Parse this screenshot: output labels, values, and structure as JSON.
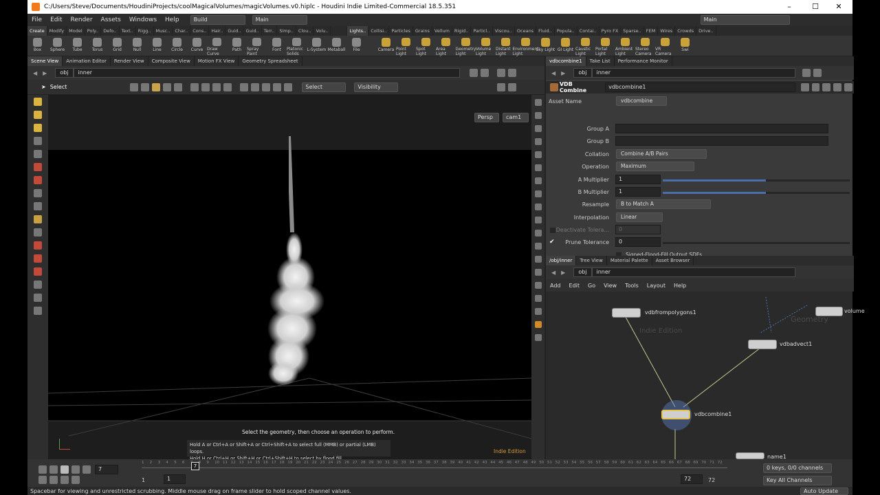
{
  "window": {
    "title": "C:/Users/Steve/Documents/HoudiniProjects/coolMagicalVolumes/magicVolumes.v0.hiplc - Houdini Indie Limited-Commercial 18.5.351",
    "min": "–",
    "max": "☐",
    "close": "✕"
  },
  "menu": {
    "items": [
      "File",
      "Edit",
      "Render",
      "Assets",
      "Windows",
      "Help"
    ],
    "desktop": "Build",
    "desktop2": "Main",
    "desktop_right": "Main"
  },
  "shelf_tabs_left": [
    "Create",
    "Modify",
    "Model",
    "Poly..",
    "Defo..",
    "Text..",
    "Rigg..",
    "Musc..",
    "Char..",
    "Cons..",
    "Hair..",
    "Guid..",
    "Guid..",
    "Terr..",
    "Simp..",
    "Clou..",
    "Volu.."
  ],
  "shelf_tabs_right": [
    "Lights..",
    "Collisi..",
    "Particles",
    "Grains",
    "Vellum",
    "Rigid..",
    "Particl..",
    "Viscou..",
    "Oceans",
    "Fluid..",
    "Popula..",
    "Contai..",
    "Pyro FX",
    "Sparse..",
    "FEM",
    "Wires",
    "Crowds",
    "Drive.."
  ],
  "tools_left": [
    "Box",
    "Sphere",
    "Tube",
    "Torus",
    "Grid",
    "Null",
    "Line",
    "Circle",
    "Curve",
    "Draw Curve",
    "Path",
    "Spray Paint",
    "Font",
    "Platonic Solids",
    "L-System",
    "Metaball",
    "File"
  ],
  "tools_right": [
    "Camera",
    "Point Light",
    "Spot Light",
    "Area Light",
    "Geometry Light",
    "Volume Light",
    "Distant Light",
    "Environment Light",
    "Sky Light",
    "GI Light",
    "Caustic Light",
    "Portal Light",
    "Ambient Light",
    "Stereo Camera",
    "VR Camera",
    "Swi"
  ],
  "left_tabs": [
    "Scene View",
    "Animation Editor",
    "Render View",
    "Composite View",
    "Motion FX View",
    "Geometry Spreadsheet"
  ],
  "path": {
    "obj": "obj",
    "node": "inner"
  },
  "viewport": {
    "select_label": "Select",
    "select_mode": "Select",
    "visibility": "Visibility",
    "persp": "Persp",
    "cam": "cam1",
    "hint_title": "Select the geometry, then choose an operation to perform.",
    "hint_line1": "Hold A or Ctrl+A or Shift+A or Ctrl+Shift+A to select full (MMB) or partial (LMB) loops.",
    "hint_line2": "Hold H or Ctrl+H or Shift+H or Ctrl+Shift+H to select by flood fill.",
    "edition": "Indie Edition"
  },
  "right_tabs": [
    "vdbcombine1",
    "Take List",
    "Performance Monitor"
  ],
  "params": {
    "type": "VDB Combine",
    "name": "vdbcombine1",
    "asset_label": "Asset Name",
    "asset_value": "vdbcombine",
    "group_a": "Group A",
    "group_b": "Group B",
    "collation_label": "Collation",
    "collation": "Combine A/B Pairs",
    "operation_label": "Operation",
    "operation": "Maximum",
    "a_mult_label": "A Multiplier",
    "a_mult": "1",
    "b_mult_label": "B Multiplier",
    "b_mult": "1",
    "resample_label": "Resample",
    "resample": "B to Match A",
    "interp_label": "Interpolation",
    "interp": "Linear",
    "deactivate_label": "Deactivate Tolera...",
    "deactivate": "0",
    "prune_label": "Prune Tolerance",
    "prune": "0",
    "sdf_label": "Signed-Flood-Fill Output SDFs"
  },
  "net_tabs": [
    "/obj/inner",
    "Tree View",
    "Material Palette",
    "Asset Browser"
  ],
  "net_menu": [
    "Add",
    "Edit",
    "Go",
    "View",
    "Tools",
    "Layout",
    "Help"
  ],
  "nodes": {
    "n1": "vdbfrompolygons1",
    "n2": "vdbadvect1",
    "n3": "vdbcombine1",
    "n4": "name1",
    "n5": "volume",
    "watermark1": "Indie Edition",
    "watermark2": "Geometry"
  },
  "timeline": {
    "frame": "7",
    "start": "1",
    "start2": "1",
    "end": "72",
    "end2": "72",
    "ticks": [
      "1",
      "2",
      "3",
      "4",
      "5",
      "6",
      "7",
      "8",
      "9",
      "10",
      "11",
      "12",
      "13",
      "14",
      "15",
      "16",
      "17",
      "18",
      "19",
      "20",
      "21",
      "22",
      "23",
      "24",
      "25",
      "26",
      "27",
      "28",
      "29",
      "30",
      "31",
      "32",
      "33",
      "34",
      "35",
      "36",
      "37",
      "38",
      "39",
      "40",
      "41",
      "42",
      "43",
      "44",
      "45",
      "46",
      "47",
      "48",
      "49",
      "50",
      "51",
      "52",
      "53",
      "54",
      "55",
      "56",
      "57",
      "58",
      "59",
      "60",
      "61",
      "62",
      "63",
      "64",
      "65",
      "66",
      "67",
      "68",
      "69",
      "70",
      "71",
      "72"
    ],
    "keys": "0 keys, 0/0 channels",
    "key_all": "Key All Channels",
    "auto": "Auto Update"
  },
  "status": "Spacebar for viewing and unrestricted scrubbing. Middle mouse drag on frame slider to hold scoped channel values."
}
